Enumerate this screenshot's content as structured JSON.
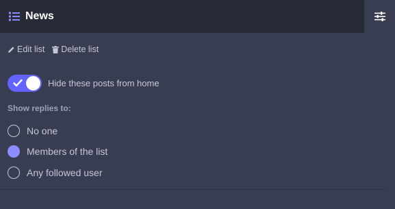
{
  "header": {
    "title": "News",
    "list_icon": "list-icon",
    "settings_icon": "sliders-icon"
  },
  "actions": {
    "edit_label": "Edit list",
    "delete_label": "Delete list"
  },
  "toggle": {
    "label": "Hide these posts from home",
    "on": true
  },
  "replies": {
    "label": "Show replies to:",
    "options": [
      {
        "label": "No one",
        "checked": false
      },
      {
        "label": "Members of the list",
        "checked": true
      },
      {
        "label": "Any followed user",
        "checked": false
      }
    ]
  },
  "colors": {
    "accent": "#6364ff",
    "radio_checked": "#8c8dff",
    "background": "#393d51",
    "header": "#282a38"
  }
}
